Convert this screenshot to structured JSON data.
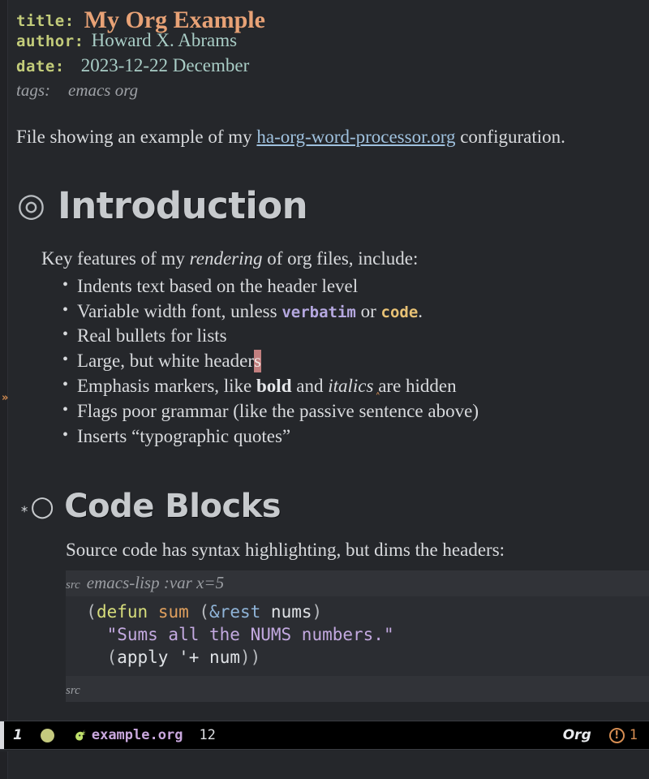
{
  "document": {
    "meta": [
      {
        "key": "title:",
        "value": "My Org Example"
      },
      {
        "key": "author:",
        "value": "Howard X. Abrams"
      },
      {
        "key": "date:",
        "value": "2023-12-22 December"
      },
      {
        "key": "tags:",
        "value": "emacs org"
      }
    ],
    "lead": {
      "before": "File showing an example of my ",
      "link": "ha-org-word-processor.org",
      "after": " configuration."
    },
    "sections": [
      {
        "bullet": "◎",
        "stars": "",
        "title": "Introduction",
        "intro_before": "Key features of my ",
        "intro_italic": "rendering",
        "intro_after": " of org files, include:",
        "bullets": [
          {
            "text": "Indents text based on the header level"
          },
          {
            "prefix": "Variable width font, unless ",
            "verbatim": "verbatim",
            "mid": " or ",
            "code": "code",
            "suffix": "."
          },
          {
            "text": "Real bullets for lists"
          },
          {
            "prefix": "Large, but white header",
            "cursor": "s",
            "suffix": ""
          },
          {
            "prefix": "Emphasis markers, like ",
            "bold": "bold",
            "mid": " and ",
            "italic": "italics",
            "suffix": " are hidden"
          },
          {
            "text": "Flags poor grammar (like the passive sentence above)"
          },
          {
            "text": "Inserts “typographic quotes”"
          }
        ]
      },
      {
        "bullet": "○",
        "stars": "*",
        "title": "Code Blocks",
        "intro": "Source code has syntax highlighting, but dims the headers:",
        "src_block": {
          "begin_keyword": "src",
          "header_args": "emacs-lisp :var x=5",
          "end_keyword": "src",
          "lines": [
            [
              {
                "t": "  (",
                "c": "t-paren"
              },
              {
                "t": "defun",
                "c": "t-defun"
              },
              {
                "t": " ",
                "c": "t-sym"
              },
              {
                "t": "sum",
                "c": "t-fname"
              },
              {
                "t": " (",
                "c": "t-paren"
              },
              {
                "t": "&rest",
                "c": "t-amp"
              },
              {
                "t": " ",
                "c": "t-sym"
              },
              {
                "t": "nums",
                "c": "t-var"
              },
              {
                "t": ")",
                "c": "t-paren"
              }
            ],
            [
              {
                "t": "    ",
                "c": "t-sym"
              },
              {
                "t": "\"Sums all the NUMS numbers.\"",
                "c": "t-str"
              }
            ],
            [
              {
                "t": "    (",
                "c": "t-paren"
              },
              {
                "t": "apply",
                "c": "t-sym"
              },
              {
                "t": " ",
                "c": "t-sym"
              },
              {
                "t": "'+",
                "c": "t-var"
              },
              {
                "t": " ",
                "c": "t-sym"
              },
              {
                "t": "num",
                "c": "t-var"
              },
              {
                "t": "))",
                "c": "t-paren"
              }
            ]
          ]
        }
      }
    ],
    "fringe_marker": "»"
  },
  "modeline": {
    "window_number": "1",
    "status_dot": "status-dot",
    "evil_icon": "evil-unicorn-icon",
    "buffer_name": "example.org",
    "line_number": "12",
    "major_mode": "Org",
    "warning_icon": "!",
    "warning_count": "1"
  },
  "colors": {
    "background": "#25272b",
    "fringe": "#212226",
    "title": "#e8a276",
    "keyword": "#c3cc7a",
    "meta_value": "#a9cdc6",
    "link": "#9fc1de",
    "heading": "#c7cacd",
    "cursor": "#c27f7f",
    "verbatim": "#b5a8e0",
    "code": "#e8c275",
    "src_background": "#2b2d32",
    "src_header_background": "#313338",
    "modeline_background": "#000000",
    "buffer_name": "#c9a7dd",
    "warning": "#d68d52",
    "status_dot": "#c4c97e"
  }
}
